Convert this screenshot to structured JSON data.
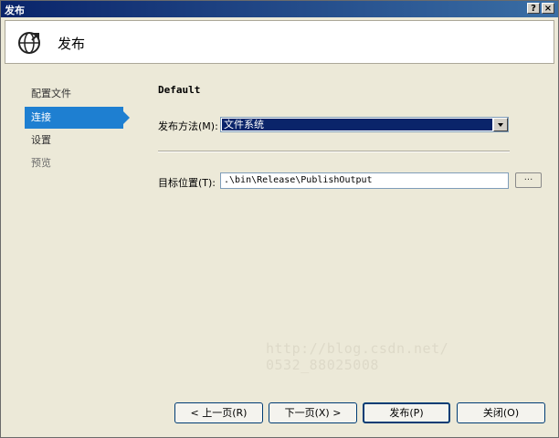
{
  "window": {
    "title": "发布",
    "help_button": "?",
    "close_button": "×"
  },
  "header": {
    "title": "发布",
    "icon": "globe-publish-icon"
  },
  "nav": {
    "items": [
      {
        "label": "配置文件",
        "state": "normal"
      },
      {
        "label": "连接",
        "state": "selected"
      },
      {
        "label": "设置",
        "state": "normal"
      },
      {
        "label": "预览",
        "state": "disabled"
      }
    ]
  },
  "main": {
    "profile_name": "Default",
    "publish_method": {
      "label": "发布方法(M):",
      "value": "文件系统"
    },
    "target_location": {
      "label": "目标位置(T):",
      "value": ".\\bin\\Release\\PublishOutput",
      "browse_label": "..."
    }
  },
  "watermark": "http://blog.csdn.net/ 0532_88025008",
  "buttons": {
    "prev": "< 上一页(R)",
    "next": "下一页(X) >",
    "publish": "发布(P)",
    "close": "关闭(O)"
  },
  "colors": {
    "title_bar": "#0a246a",
    "nav_selected": "#1e7fd1",
    "select_highlight": "#0a246a",
    "dialog_background": "#ece9d8"
  }
}
